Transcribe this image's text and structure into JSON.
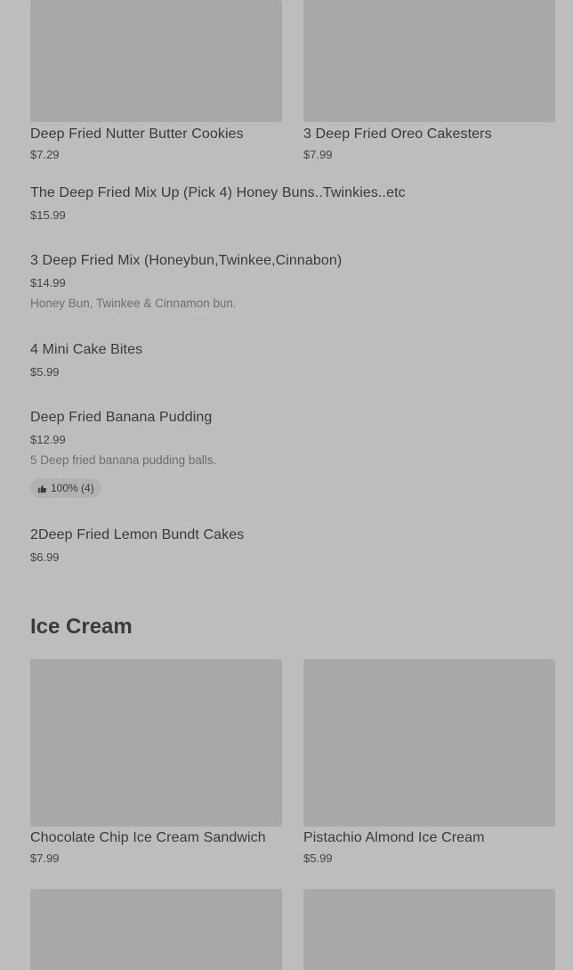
{
  "top_cards": [
    {
      "name": "Deep Fried Nutter Butter Cookies",
      "price": "$7.29"
    },
    {
      "name": "3 Deep Fried Oreo Cakesters",
      "price": "$7.99"
    }
  ],
  "list_items": [
    {
      "name": "The Deep Fried Mix Up (Pick 4) Honey Buns..Twinkies..etc",
      "price": "$15.99"
    },
    {
      "name": "3 Deep Fried Mix (Honeybun,Twinkee,Cinnabon)",
      "price": "$14.99",
      "description": "Honey Bun, Twinkee & Cinnamon bun."
    },
    {
      "name": "4 Mini Cake Bites",
      "price": "$5.99"
    },
    {
      "name": "Deep Fried Banana Pudding",
      "price": "$12.99",
      "description": "5 Deep fried banana pudding balls.",
      "rating": "100% (4)"
    },
    {
      "name": "2Deep Fried Lemon Bundt Cakes",
      "price": "$6.99"
    }
  ],
  "ice_cream": {
    "title": "Ice Cream",
    "cards": [
      {
        "name": "Chocolate Chip Ice Cream Sandwich",
        "price": "$7.99"
      },
      {
        "name": "Pistachio  Almond Ice Cream",
        "price": "$5.99"
      }
    ]
  },
  "icons": {
    "rating": "thumbs-up-icon"
  }
}
